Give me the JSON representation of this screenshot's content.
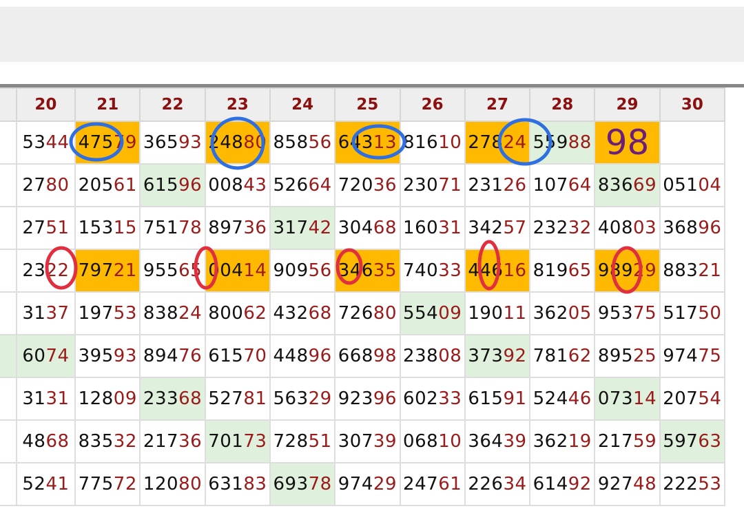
{
  "header": {
    "columns": [
      "",
      "20",
      "21",
      "22",
      "23",
      "24",
      "25",
      "26",
      "27",
      "28",
      "29",
      "30"
    ]
  },
  "colors": {
    "green": "#dff0dc",
    "orange": "#ffba00",
    "red_digits": "#9b1a1a",
    "blue_mark": "#2f6fe0",
    "red_mark": "#e03040"
  },
  "rows": [
    [
      {
        "h": "",
        "t": ""
      },
      {
        "h": "53",
        "t": "44"
      },
      {
        "h": "475",
        "t": "79",
        "s": "co"
      },
      {
        "h": "365",
        "t": "93"
      },
      {
        "h": "248",
        "t": "80",
        "s": "co"
      },
      {
        "h": "858",
        "t": "56"
      },
      {
        "h": "643",
        "t": "13",
        "s": "co"
      },
      {
        "h": "816",
        "t": "10"
      },
      {
        "h": "278",
        "t": "24",
        "s": "co"
      },
      {
        "h": "559",
        "t": "88",
        "s": "cg"
      },
      {
        "h": "98",
        "t": "",
        "s": "co big"
      },
      {
        "h": "",
        "t": ""
      }
    ],
    [
      {
        "h": "",
        "t": ""
      },
      {
        "h": "27",
        "t": "80"
      },
      {
        "h": "205",
        "t": "61"
      },
      {
        "h": "615",
        "t": "96",
        "s": "cg"
      },
      {
        "h": "008",
        "t": "43"
      },
      {
        "h": "526",
        "t": "64"
      },
      {
        "h": "720",
        "t": "36"
      },
      {
        "h": "230",
        "t": "71"
      },
      {
        "h": "231",
        "t": "26"
      },
      {
        "h": "107",
        "t": "64"
      },
      {
        "h": "836",
        "t": "69",
        "s": "cg"
      },
      {
        "h": "051",
        "t": "04"
      }
    ],
    [
      {
        "h": "",
        "t": ""
      },
      {
        "h": "27",
        "t": "51"
      },
      {
        "h": "153",
        "t": "15"
      },
      {
        "h": "751",
        "t": "78"
      },
      {
        "h": "897",
        "t": "36"
      },
      {
        "h": "317",
        "t": "42",
        "s": "cg"
      },
      {
        "h": "304",
        "t": "68"
      },
      {
        "h": "160",
        "t": "31"
      },
      {
        "h": "342",
        "t": "57"
      },
      {
        "h": "232",
        "t": "32"
      },
      {
        "h": "408",
        "t": "03"
      },
      {
        "h": "368",
        "t": "96"
      }
    ],
    [
      {
        "h": "",
        "t": ""
      },
      {
        "h": "23",
        "t": "22"
      },
      {
        "h": "797",
        "t": "21",
        "s": "co"
      },
      {
        "h": "955",
        "t": "65"
      },
      {
        "h": "004",
        "t": "14",
        "s": "co"
      },
      {
        "h": "909",
        "t": "56"
      },
      {
        "h": "346",
        "t": "35",
        "s": "co"
      },
      {
        "h": "740",
        "t": "33"
      },
      {
        "h": "446",
        "t": "16",
        "s": "co"
      },
      {
        "h": "819",
        "t": "65"
      },
      {
        "h": "989",
        "t": "29",
        "s": "co"
      },
      {
        "h": "883",
        "t": "21"
      }
    ],
    [
      {
        "h": "",
        "t": ""
      },
      {
        "h": "31",
        "t": "37"
      },
      {
        "h": "197",
        "t": "53"
      },
      {
        "h": "838",
        "t": "24"
      },
      {
        "h": "800",
        "t": "62"
      },
      {
        "h": "432",
        "t": "68"
      },
      {
        "h": "726",
        "t": "80"
      },
      {
        "h": "554",
        "t": "09",
        "s": "cg"
      },
      {
        "h": "190",
        "t": "11"
      },
      {
        "h": "362",
        "t": "05"
      },
      {
        "h": "953",
        "t": "75"
      },
      {
        "h": "517",
        "t": "50"
      }
    ],
    [
      {
        "h": "",
        "t": "",
        "s": "cg"
      },
      {
        "h": "60",
        "t": "74",
        "s": "cg"
      },
      {
        "h": "395",
        "t": "93"
      },
      {
        "h": "894",
        "t": "76"
      },
      {
        "h": "615",
        "t": "70"
      },
      {
        "h": "448",
        "t": "96"
      },
      {
        "h": "668",
        "t": "98"
      },
      {
        "h": "238",
        "t": "08"
      },
      {
        "h": "373",
        "t": "92",
        "s": "cg"
      },
      {
        "h": "781",
        "t": "62"
      },
      {
        "h": "895",
        "t": "25"
      },
      {
        "h": "974",
        "t": "75"
      }
    ],
    [
      {
        "h": "",
        "t": ""
      },
      {
        "h": "31",
        "t": "31"
      },
      {
        "h": "128",
        "t": "09"
      },
      {
        "h": "233",
        "t": "68",
        "s": "cg"
      },
      {
        "h": "527",
        "t": "81"
      },
      {
        "h": "563",
        "t": "29"
      },
      {
        "h": "923",
        "t": "96"
      },
      {
        "h": "602",
        "t": "33"
      },
      {
        "h": "615",
        "t": "91"
      },
      {
        "h": "524",
        "t": "46"
      },
      {
        "h": "073",
        "t": "14",
        "s": "cg"
      },
      {
        "h": "207",
        "t": "54"
      }
    ],
    [
      {
        "h": "",
        "t": ""
      },
      {
        "h": "48",
        "t": "68"
      },
      {
        "h": "835",
        "t": "32"
      },
      {
        "h": "217",
        "t": "36"
      },
      {
        "h": "701",
        "t": "73",
        "s": "cg"
      },
      {
        "h": "728",
        "t": "51"
      },
      {
        "h": "307",
        "t": "39"
      },
      {
        "h": "068",
        "t": "10"
      },
      {
        "h": "364",
        "t": "39"
      },
      {
        "h": "362",
        "t": "19"
      },
      {
        "h": "217",
        "t": "59"
      },
      {
        "h": "597",
        "t": "63",
        "s": "cg"
      }
    ],
    [
      {
        "h": "",
        "t": ""
      },
      {
        "h": "52",
        "t": "41"
      },
      {
        "h": "775",
        "t": "72"
      },
      {
        "h": "120",
        "t": "80"
      },
      {
        "h": "631",
        "t": "83"
      },
      {
        "h": "693",
        "t": "78",
        "s": "cg"
      },
      {
        "h": "974",
        "t": "29"
      },
      {
        "h": "247",
        "t": "61"
      },
      {
        "h": "226",
        "t": "34"
      },
      {
        "h": "614",
        "t": "92"
      },
      {
        "h": "927",
        "t": "48"
      },
      {
        "h": "222",
        "t": "53"
      }
    ]
  ]
}
